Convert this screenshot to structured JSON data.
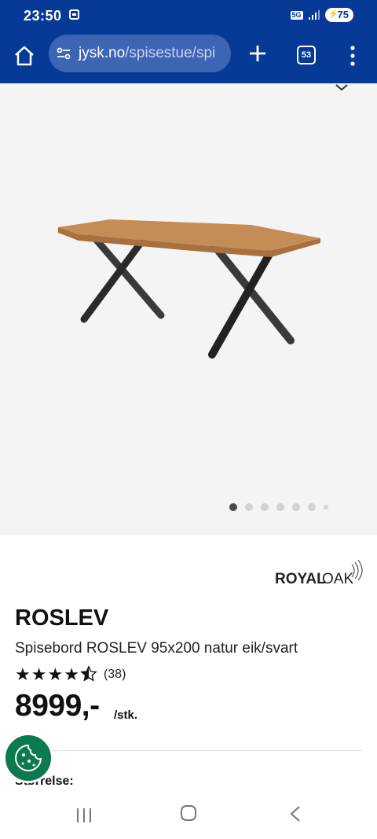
{
  "status": {
    "time": "23:50",
    "network": "5G",
    "battery": "75"
  },
  "browser": {
    "url_domain": "jysk.no",
    "url_path": "/spisestue/spi",
    "tab_count": "53"
  },
  "gallery": {
    "dot_count": 7,
    "active_index": 0
  },
  "brand": {
    "logo_text_bold": "ROYAL",
    "logo_text_light": "OAK"
  },
  "product": {
    "name": "ROSLEV",
    "description": "Spisebord ROSLEV 95x200 natur eik/svart",
    "rating": 4.5,
    "rating_count": "(38)",
    "price": "8999,-",
    "unit": "/stk."
  },
  "options": {
    "size_label": "Størrelse:"
  },
  "colors": {
    "header_bg": "#063a96",
    "url_pill_bg": "#3d65b3",
    "cookie_btn": "#0b7a4e"
  }
}
